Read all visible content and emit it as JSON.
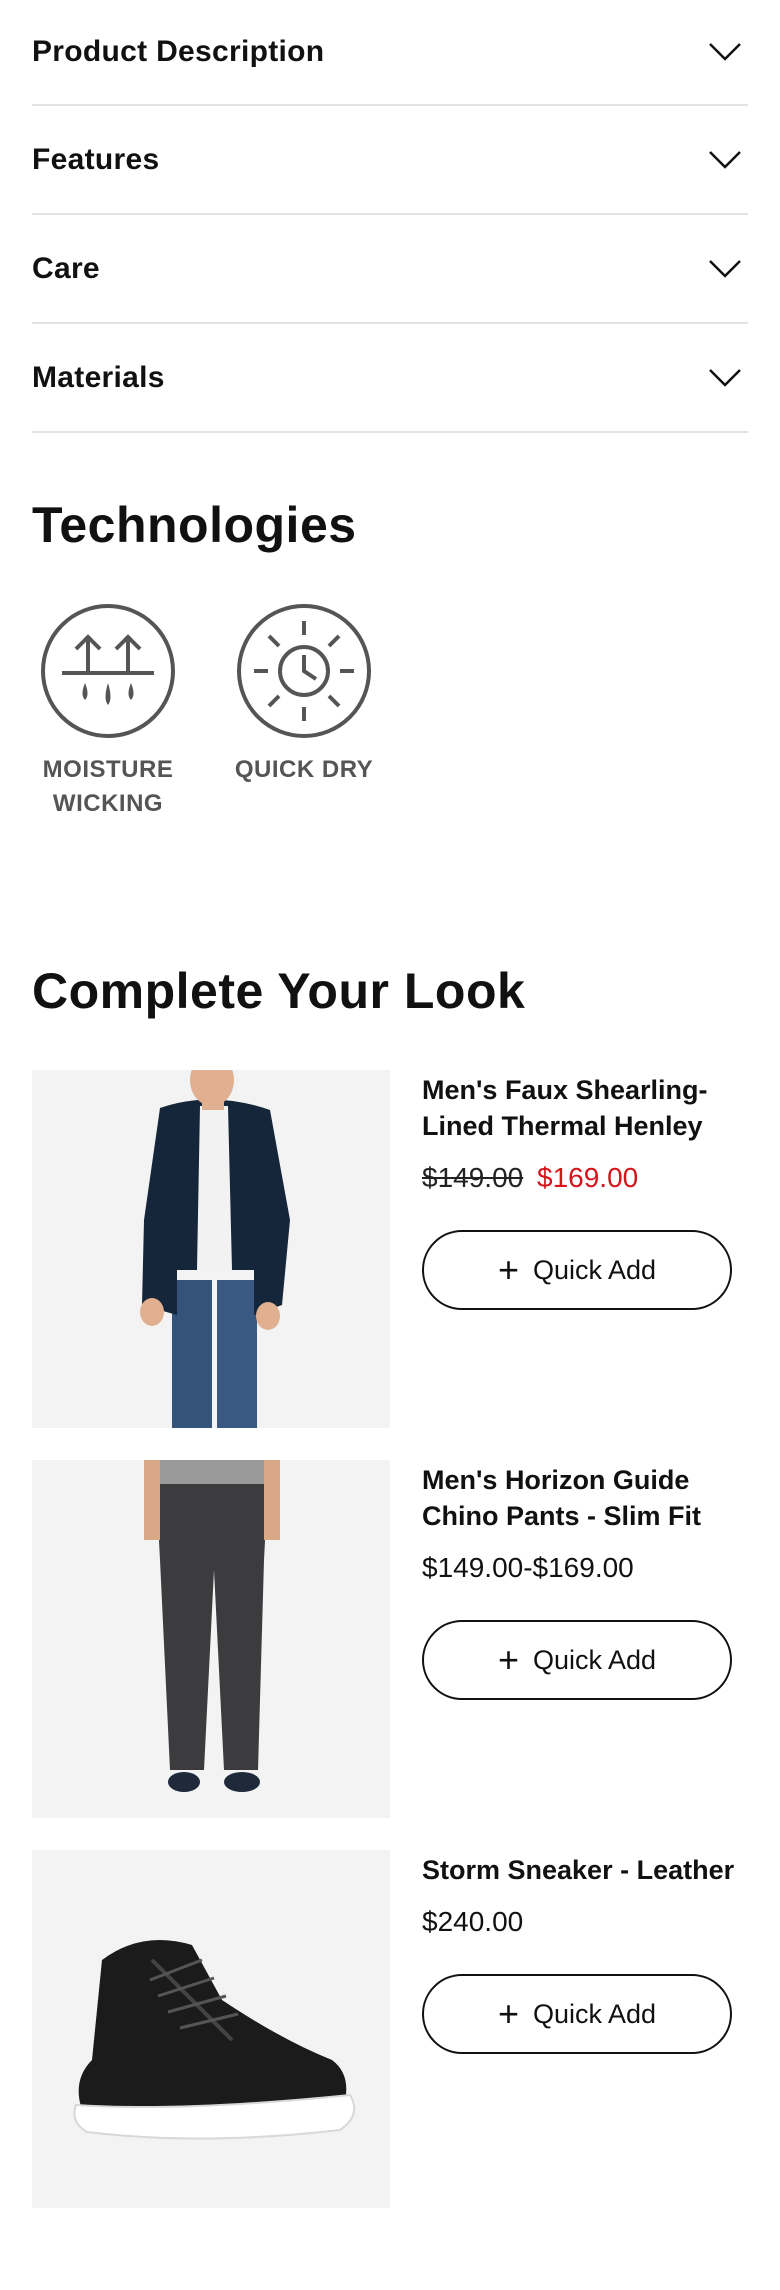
{
  "accordion": [
    {
      "label": "Product Description"
    },
    {
      "label": "Features"
    },
    {
      "label": "Care"
    },
    {
      "label": "Materials"
    }
  ],
  "technologies": {
    "title": "Technologies",
    "items": [
      {
        "icon": "moisture-wicking-icon",
        "label": "MOISTURE WICKING"
      },
      {
        "icon": "quick-dry-icon",
        "label": "QUICK DRY"
      }
    ]
  },
  "complete_look": {
    "title": "Complete Your Look",
    "products": [
      {
        "name": "Men's Faux Shearling-Lined Thermal Henley",
        "price_old": "$149.00",
        "price_sale": "$169.00",
        "price": "",
        "button": "Quick Add",
        "image": "man-in-navy-blazer"
      },
      {
        "name": "Men's Horizon Guide Chino Pants - Slim Fit",
        "price_old": "",
        "price_sale": "",
        "price": "$149.00-$169.00",
        "button": "Quick Add",
        "image": "grey-chino-pants"
      },
      {
        "name": "Storm Sneaker - Leather",
        "price_old": "",
        "price_sale": "",
        "price": "$240.00",
        "button": "Quick Add",
        "image": "black-high-top-sneaker"
      }
    ]
  },
  "colors": {
    "sale": "#d3151b",
    "divider": "#e3e3e3",
    "icon": "#555555"
  }
}
